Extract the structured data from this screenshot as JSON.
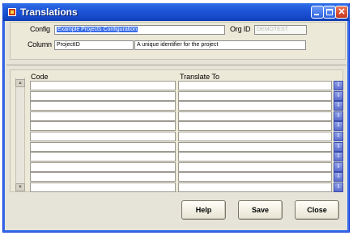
{
  "window": {
    "title": "Translations"
  },
  "header": {
    "config_label": "Config",
    "config_value": "Example Projects Configuration",
    "org_label": "Org ID",
    "org_value": "DEMOTEST",
    "column_label": "Column",
    "column_value": "ProjectID",
    "column_description": "A unique identifier for the project"
  },
  "grid": {
    "code_header": "Code",
    "translate_header": "Translate To",
    "rows": [
      {
        "code": "",
        "translate": ""
      },
      {
        "code": "",
        "translate": ""
      },
      {
        "code": "",
        "translate": ""
      },
      {
        "code": "",
        "translate": ""
      },
      {
        "code": "",
        "translate": ""
      },
      {
        "code": "",
        "translate": ""
      },
      {
        "code": "",
        "translate": ""
      },
      {
        "code": "",
        "translate": ""
      },
      {
        "code": "",
        "translate": ""
      },
      {
        "code": "",
        "translate": ""
      },
      {
        "code": "",
        "translate": ""
      }
    ]
  },
  "buttons": {
    "help": "Help",
    "save": "Save",
    "close": "Close"
  },
  "icons": {
    "window_icon": "app-window-icon",
    "minimize": "minimize-icon",
    "maximize": "maximize-icon",
    "close": "close-icon",
    "scroll_up": "scroll-up-icon",
    "scroll_down": "scroll-down-icon",
    "lov": "list-of-values-icon"
  }
}
